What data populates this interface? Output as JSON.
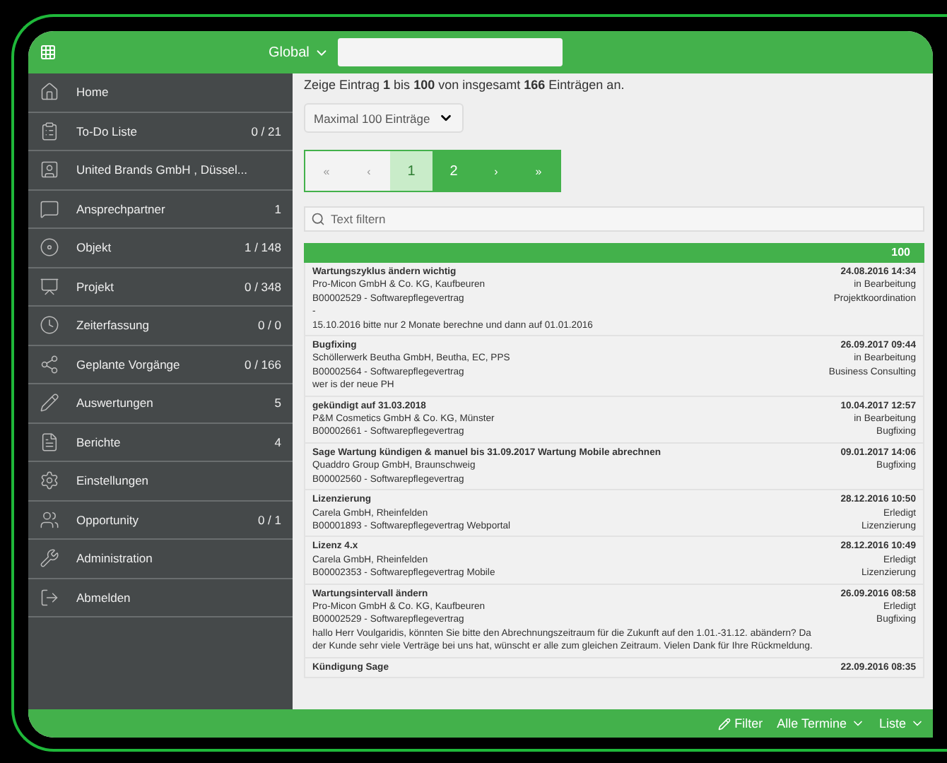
{
  "top_bar": {
    "scope": "Global"
  },
  "sidebar": {
    "items": [
      {
        "label": "Home"
      },
      {
        "label": "To-Do Liste",
        "count": "0 / 21"
      },
      {
        "label": "United Brands GmbH , Düssel..."
      },
      {
        "label": "Ansprechpartner",
        "count": "1"
      },
      {
        "label": "Objekt",
        "count": "1 / 148"
      },
      {
        "label": "Projekt",
        "count": "0 / 348"
      },
      {
        "label": "Zeiterfassung",
        "count": "0 / 0"
      },
      {
        "label": "Geplante Vorgänge",
        "count": "0 / 166"
      },
      {
        "label": "Auswertungen",
        "count": "5"
      },
      {
        "label": "Berichte",
        "count": "4"
      },
      {
        "label": "Einstellungen"
      },
      {
        "label": "Opportunity",
        "count": "0 / 1"
      },
      {
        "label": "Administration"
      },
      {
        "label": "Abmelden"
      }
    ]
  },
  "summary": "Zeige Eintrag **1** bis **100** von insgesamt **166** Einträgen an.",
  "page_size": "Maximal 100 Einträge",
  "pagination": [
    {
      "label": "«",
      "kind": "nav",
      "disabled": true,
      "selected": false
    },
    {
      "label": "‹",
      "kind": "nav",
      "disabled": true,
      "selected": false
    },
    {
      "label": "1",
      "kind": "page",
      "disabled": false,
      "selected": true
    },
    {
      "label": "2",
      "kind": "page",
      "disabled": false,
      "selected": false
    },
    {
      "label": "›",
      "kind": "nav",
      "disabled": false,
      "selected": false
    },
    {
      "label": "»",
      "kind": "nav",
      "disabled": false,
      "selected": false
    }
  ],
  "filter": {
    "placeholder": "Text filtern"
  },
  "list_header": "100",
  "entries": [
    {
      "title": "Wartungszyklus ändern wichtig",
      "date": "24.08.2016 14:34",
      "left": [
        "Pro-Micon GmbH & Co. KG, Kaufbeuren",
        "B00002529 - Softwarepflegevertrag",
        "-",
        "15.10.2016 bitte nur 2 Monate berechne und dann auf 01.01.2016"
      ],
      "right": [
        "in Bearbeitung",
        "Projektkoordination"
      ]
    },
    {
      "title": "Bugfixing",
      "date": "26.09.2017 09:44",
      "left": [
        "Schöllerwerk Beutha GmbH, Beutha, EC, PPS",
        "B00002564 - Softwarepflegevertrag",
        "wer is der neue PH"
      ],
      "right": [
        "in Bearbeitung",
        "Business Consulting"
      ]
    },
    {
      "title": "gekündigt auf 31.03.2018",
      "date": "10.04.2017 12:57",
      "left": [
        "P&M Cosmetics GmbH & Co. KG, Münster",
        "B00002661 - Softwarepflegevertrag"
      ],
      "right": [
        "in Bearbeitung",
        "Bugfixing"
      ]
    },
    {
      "title": "Sage Wartung kündigen & manuel bis 31.09.2017 Wartung Mobile abrechnen",
      "date": "09.01.2017 14:06",
      "left": [
        "Quaddro Group GmbH, Braunschweig",
        "B00002560 - Softwarepflegevertrag"
      ],
      "right": [
        "Bugfixing"
      ]
    },
    {
      "title": "Lizenzierung",
      "date": "28.12.2016 10:50",
      "left": [
        "Carela GmbH, Rheinfelden",
        "B00001893 - Softwarepflegevertrag Webportal"
      ],
      "right": [
        "Erledigt",
        "Lizenzierung"
      ]
    },
    {
      "title": "Lizenz 4.x",
      "date": "28.12.2016 10:49",
      "left": [
        "Carela GmbH, Rheinfelden",
        "B00002353 - Softwarepflegevertrag Mobile"
      ],
      "right": [
        "Erledigt",
        "Lizenzierung"
      ]
    },
    {
      "title": "Wartungsintervall ändern",
      "date": "26.09.2016 08:58",
      "left": [
        "Pro-Micon GmbH & Co. KG, Kaufbeuren",
        "B00002529 - Softwarepflegevertrag",
        "hallo Herr Voulgaridis, könnten Sie bitte den Abrechnungszeitraum für die Zukunft auf den 1.01.-31.12. abändern? Da der Kunde sehr viele Verträge bei uns hat, wünscht er alle zum gleichen Zeitraum. Vielen Dank für Ihre Rückmeldung."
      ],
      "right": [
        "Erledigt",
        "Bugfixing"
      ]
    },
    {
      "title": "Kündigung Sage",
      "date": "22.09.2016 08:35"
    }
  ],
  "bottom_bar": {
    "filter": "Filter",
    "range": "Alle Termine",
    "view": "Liste"
  }
}
